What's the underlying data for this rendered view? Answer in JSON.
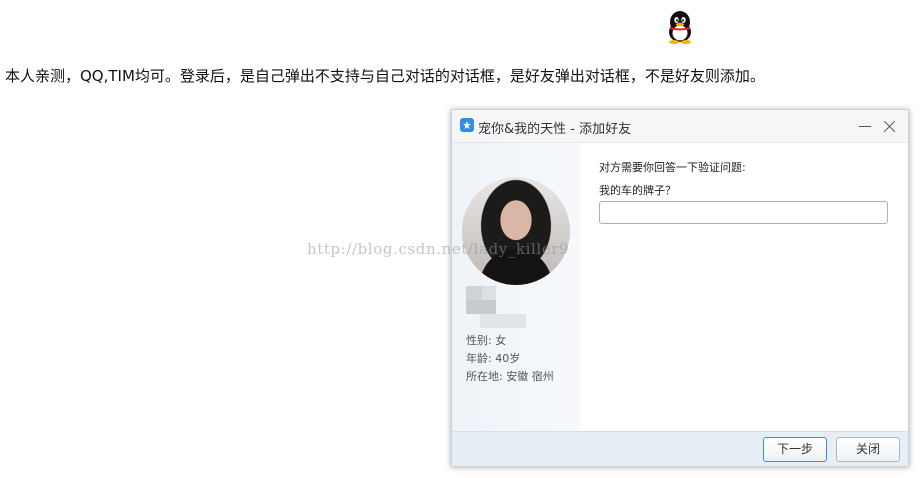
{
  "logo": {
    "icon": "qq-penguin-icon"
  },
  "intro_text": "本人亲测，QQ,TIM均可。登录后，是自己弹出不支持与自己对话的对话框，是好友弹出对话框，不是好友则添加。",
  "dialog": {
    "title": "宠你&我的天性 - 添加好友",
    "title_icon": "qq-star-icon",
    "profile": {
      "gender": "性别: 女",
      "age": "年龄: 40岁",
      "location": "所在地: 安徽  宿州"
    },
    "question_label": "对方需要你回答一下验证问题:",
    "question": "我的车的牌子？",
    "answer": {
      "value": "",
      "placeholder": ""
    },
    "buttons": {
      "next": "下一步",
      "close": "关闭"
    }
  },
  "watermark": "http://blog.csdn.net/lady_killer9",
  "colors": {
    "accent": "#3d8fdc",
    "footer": "#e6eef6"
  }
}
